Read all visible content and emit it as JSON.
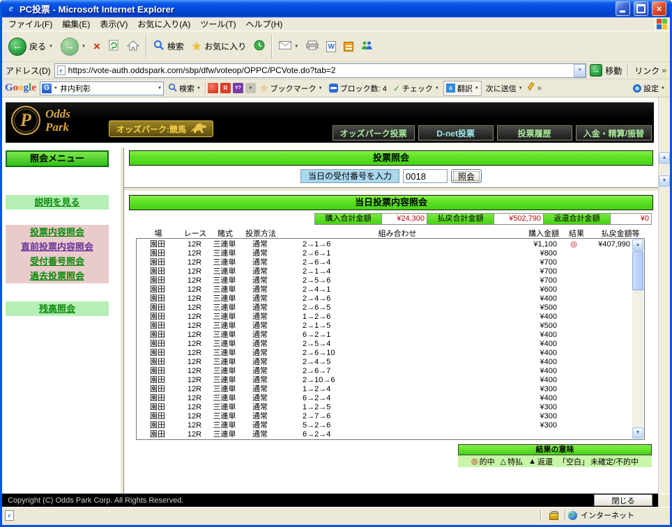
{
  "window": {
    "title": "PC投票 - Microsoft Internet Explorer"
  },
  "menu": {
    "items": [
      "ファイル(F)",
      "編集(E)",
      "表示(V)",
      "お気に入り(A)",
      "ツール(T)",
      "ヘルプ(H)"
    ]
  },
  "toolbar": {
    "back": "戻る",
    "search": "検索",
    "favorites": "お気に入り"
  },
  "address": {
    "label": "アドレス(D)",
    "url": "https://vote-auth.oddspark.com/sbp/dfw/voteop/OPPC/PCVote.do?tab=2",
    "go": "移動",
    "links": "リンク"
  },
  "google": {
    "logo": "Google",
    "query": "井内利彰",
    "search": "検索",
    "bookmarks": "ブックマーク",
    "blocked": "ブロック数: 4",
    "check": "チェック",
    "translate": "翻訳",
    "send": "次に送信",
    "settings": "設定"
  },
  "banner": {
    "brand_top": "Odds",
    "brand_bottom": "Park",
    "badge": "オッズパーク:競馬",
    "nav": [
      "オッズパーク投票",
      "D-net投票",
      "投票履歴",
      "入金・精算/振替"
    ]
  },
  "sidebar": {
    "title": "照会メニュー",
    "items": [
      {
        "label": "説明を見る",
        "tone": "green"
      },
      {
        "label": "投票内容照会",
        "tone": "pink"
      },
      {
        "label": "直前投票内容照会",
        "tone": "pink",
        "visited": true
      },
      {
        "label": "受付番号照会",
        "tone": "pink"
      },
      {
        "label": "過去投票照会",
        "tone": "pink"
      },
      {
        "label": "残高照会",
        "tone": "green"
      }
    ]
  },
  "inquiry": {
    "title": "投票照会",
    "input_label": "当日の受付番号を入力",
    "receipt_no": "0018",
    "submit": "照会"
  },
  "today": {
    "title": "当日投票内容照会",
    "summary": [
      {
        "label": "購入合計金額",
        "value": "¥24,300"
      },
      {
        "label": "払戻合計金額",
        "value": "¥502,790"
      },
      {
        "label": "返還合計金額",
        "value": "¥0"
      }
    ],
    "columns": [
      "場",
      "レース",
      "賭式",
      "投票方法",
      "組み合わせ",
      "購入金額",
      "結果",
      "払戻金額等"
    ],
    "rows": [
      [
        "園田",
        "12R",
        "三連単",
        "通常",
        "2→1→6",
        "¥1,100",
        "◎",
        "¥407,990"
      ],
      [
        "園田",
        "12R",
        "三連単",
        "通常",
        "2→6→1",
        "¥800",
        "",
        ""
      ],
      [
        "園田",
        "12R",
        "三連単",
        "通常",
        "2→6→4",
        "¥700",
        "",
        ""
      ],
      [
        "園田",
        "12R",
        "三連単",
        "通常",
        "2→1→4",
        "¥700",
        "",
        ""
      ],
      [
        "園田",
        "12R",
        "三連単",
        "通常",
        "2→5→6",
        "¥700",
        "",
        ""
      ],
      [
        "園田",
        "12R",
        "三連単",
        "通常",
        "2→4→1",
        "¥600",
        "",
        ""
      ],
      [
        "園田",
        "12R",
        "三連単",
        "通常",
        "2→4→6",
        "¥400",
        "",
        ""
      ],
      [
        "園田",
        "12R",
        "三連単",
        "通常",
        "2→6→5",
        "¥500",
        "",
        ""
      ],
      [
        "園田",
        "12R",
        "三連単",
        "通常",
        "1→2→6",
        "¥400",
        "",
        ""
      ],
      [
        "園田",
        "12R",
        "三連単",
        "通常",
        "2→1→5",
        "¥500",
        "",
        ""
      ],
      [
        "園田",
        "12R",
        "三連単",
        "通常",
        "6→2→1",
        "¥400",
        "",
        ""
      ],
      [
        "園田",
        "12R",
        "三連単",
        "通常",
        "2→5→4",
        "¥400",
        "",
        ""
      ],
      [
        "園田",
        "12R",
        "三連単",
        "通常",
        "2→6→10",
        "¥400",
        "",
        ""
      ],
      [
        "園田",
        "12R",
        "三連単",
        "通常",
        "2→4→5",
        "¥400",
        "",
        ""
      ],
      [
        "園田",
        "12R",
        "三連単",
        "通常",
        "2→6→7",
        "¥400",
        "",
        ""
      ],
      [
        "園田",
        "12R",
        "三連単",
        "通常",
        "2→10→6",
        "¥400",
        "",
        ""
      ],
      [
        "園田",
        "12R",
        "三連単",
        "通常",
        "1→2→4",
        "¥300",
        "",
        ""
      ],
      [
        "園田",
        "12R",
        "三連単",
        "通常",
        "6→2→4",
        "¥400",
        "",
        ""
      ],
      [
        "園田",
        "12R",
        "三連単",
        "通常",
        "1→2→5",
        "¥300",
        "",
        ""
      ],
      [
        "園田",
        "12R",
        "三連単",
        "通常",
        "2→7→6",
        "¥300",
        "",
        ""
      ],
      [
        "園田",
        "12R",
        "三連単",
        "通常",
        "5→2→6",
        "¥300",
        "",
        ""
      ],
      [
        "園田",
        "12R",
        "三連単",
        "通常",
        "6→2→4",
        "",
        "",
        ""
      ]
    ],
    "legend_title": "結果の意味",
    "legend": [
      {
        "symbol": "◎",
        "label": "的中"
      },
      {
        "symbol": "△",
        "label": "特払"
      },
      {
        "symbol": "▲",
        "label": "返還"
      },
      {
        "symbol": "「空白」",
        "label": "未確定/不的中"
      }
    ]
  },
  "footer": {
    "copyright": "Copyright (C) Odds Park Corp. All Rights Reserved.",
    "close": "閉じる"
  },
  "status": {
    "zone": "インターネット"
  },
  "colors": {
    "header_green": "#55DC1E",
    "amount_red": "#C00000",
    "brand_gold": "#D8A73C"
  }
}
